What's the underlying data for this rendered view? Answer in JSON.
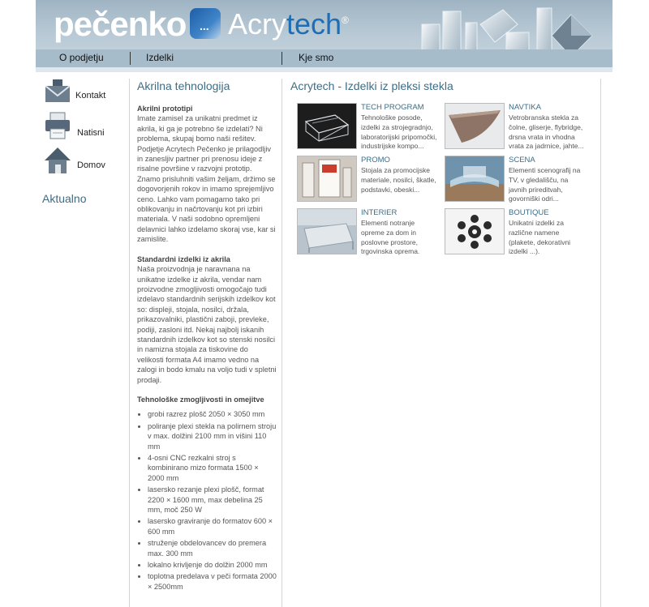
{
  "header": {
    "logo_primary": "pečenko",
    "logo_secondary_a": "Acry",
    "logo_secondary_b": "tech",
    "logo_reg": "®"
  },
  "nav": {
    "items": [
      "O podjetju",
      "Izdelki",
      "Kje smo"
    ]
  },
  "sidebar": {
    "links": [
      {
        "label": "Kontakt",
        "icon": "mail-icon"
      },
      {
        "label": "Natisni",
        "icon": "printer-icon"
      },
      {
        "label": "Domov",
        "icon": "home-icon"
      }
    ],
    "news_heading": "Aktualno"
  },
  "middle": {
    "title": "Akrilna tehnologija",
    "section1_heading": "Akrilni prototipi",
    "section1_text": "Imate zamisel za unikatni predmet iz akrila, ki ga je potrebno še izdelati? Ni problema, skupaj bomo naši rešitev. Podjetje Acrytech Pečenko je prilagodljiv in zanesljiv partner pri prenosu ideje z risalne površine v razvojni prototip. Znamo prisluhniti vašim željam, držimo se dogovorjenih rokov in imamo sprejemljivo ceno. Lahko vam pomagamo tako pri oblikovanju in načrtovanju kot pri izbiri materiala. V naši sodobno opremljeni delavnici lahko izdelamo skoraj vse, kar si zamislite.",
    "section2_heading": "Standardni izdelki iz akrila",
    "section2_text": "Naša proizvodnja je naravnana na unikatne izdelke iz akrila, vendar nam proizvodne zmogljivosti omogočajo tudi izdelavo standardnih serijskih izdelkov kot so: displeji, stojala, nosilci, držala, prikazovalniki, plastični zaboji, prevleke, podiji, zasloni itd. Nekaj najbolj iskanih standardnih izdelkov kot so stenski nosilci in namizna stojala za tiskovine do velikosti formata A4 imamo vedno na zalogi in bodo kmalu na voljo tudi v spletni prodaji.",
    "section3_heading": "Tehnološke zmogljivosti in omejitve",
    "bullets": [
      "grobi razrez plošč 2050 × 3050 mm",
      "poliranje plexi stekla na polirnem stroju v max. dolžini 2100 mm in višini 110 mm",
      "4-osni CNC rezkalni stroj s kombinirano mizo formata 1500 × 2000 mm",
      "lasersko rezanje plexi plošč, format 2200 × 1600 mm, max debelina 25 mm, moč 250 W",
      "lasersko graviranje do formatov 600 × 600 mm",
      "struženje obdelovancev do premera max. 300 mm",
      "lokalno krivljenje do dolžin 2000 mm",
      "toplotna predelava v peči formata 2000 × 2500mm"
    ]
  },
  "right": {
    "title": "Acrytech - Izdelki iz pleksi stekla",
    "cards": [
      {
        "title": "TECH PROGRAM",
        "desc": "Tehnološke posode, izdelki za strojegradnjo, laboratorijski pripomočki, industrijske kompo..."
      },
      {
        "title": "NAVTIKA",
        "desc": "Vetrobranska stekla za čolne, gliserje, flybridge, drsna vrata in vhodna vrata za jadrnice, jahte..."
      },
      {
        "title": "PROMO",
        "desc": "Stojala za promocijske materiale, nosilci, škatle, podstavki, obeski..."
      },
      {
        "title": "SCENA",
        "desc": "Elementi scenografij na TV, v gledališču, na javnih prireditvah, govorniški odri..."
      },
      {
        "title": "INTERIER",
        "desc": "Elementi notranje opreme za dom in poslovne prostore, trgovinska oprema."
      },
      {
        "title": "BOUTIQUE",
        "desc": "Unikatni izdelki za različne namene (plakete, dekorativni izdelki ...)."
      }
    ]
  }
}
